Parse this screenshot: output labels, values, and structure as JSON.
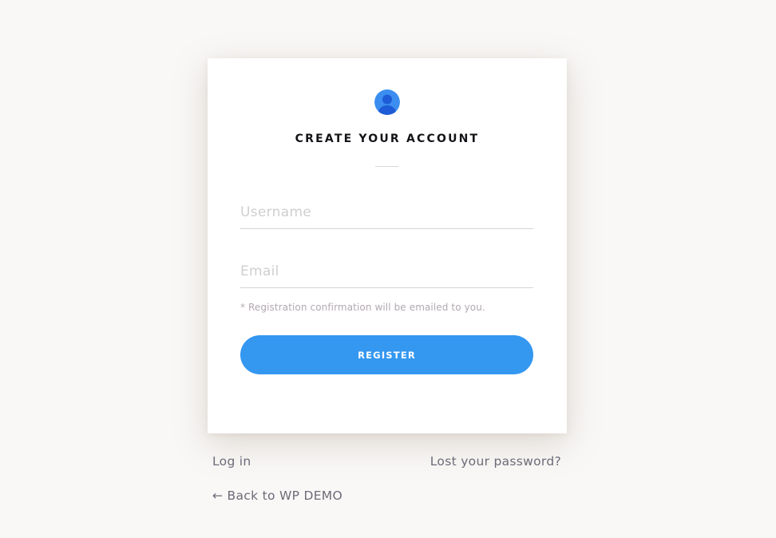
{
  "card": {
    "title": "CREATE YOUR ACCOUNT",
    "avatar_icon": "user-avatar-icon",
    "username": {
      "placeholder": "Username",
      "value": ""
    },
    "email": {
      "placeholder": "Email",
      "value": ""
    },
    "note": "* Registration confirmation will be emailed to you.",
    "register_label": "REGISTER"
  },
  "links": {
    "login": "Log in",
    "lost_password": "Lost your password?",
    "back": "← Back to WP DEMO"
  },
  "colors": {
    "accent": "#3497f0",
    "background": "#f9f8f6",
    "avatar_light": "#3b8ef0",
    "avatar_dark": "#1d5cd6"
  }
}
